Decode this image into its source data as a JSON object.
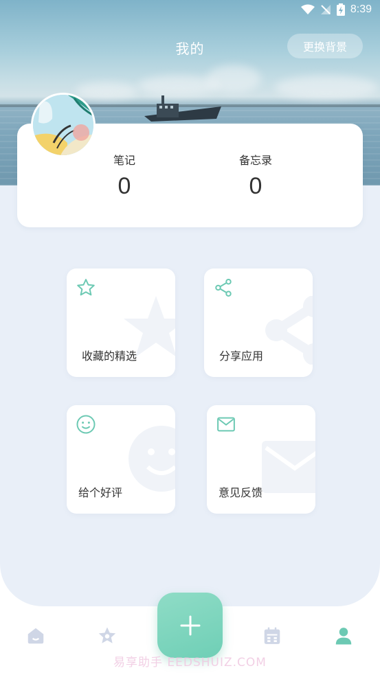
{
  "status_bar": {
    "time": "8:39"
  },
  "header": {
    "title": "我的",
    "change_background_label": "更换背景"
  },
  "profile": {
    "stats": [
      {
        "label": "笔记",
        "value": "0"
      },
      {
        "label": "备忘录",
        "value": "0"
      }
    ]
  },
  "tiles": [
    {
      "label": "收藏的精选",
      "icon": "star-icon"
    },
    {
      "label": "分享应用",
      "icon": "share-icon"
    },
    {
      "label": "给个好评",
      "icon": "smiley-icon"
    },
    {
      "label": "意见反馈",
      "icon": "mail-icon"
    }
  ],
  "bottom_nav": {
    "items": [
      "home-icon",
      "star-badge-icon",
      "calendar-icon",
      "profile-icon"
    ],
    "active": "profile-icon",
    "fab_icon": "plus-icon"
  },
  "watermark": "易享助手 EEDSHUIZ.COM",
  "colors": {
    "accent": "#6fcfb6",
    "icon_green": "#6cc9b3",
    "nav_inactive": "#cfd6e6",
    "background": "#e9eff8"
  }
}
